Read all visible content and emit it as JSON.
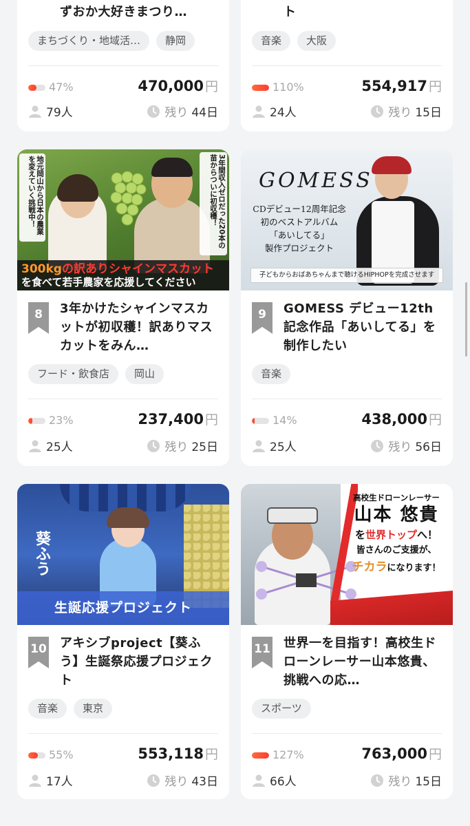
{
  "cards": [
    {
      "rank": "",
      "title": "ずおか大好きまつり…",
      "tags": [
        "まちづくり・地域活…",
        "静岡"
      ],
      "percent": "47%",
      "progress": 0.47,
      "amount": "470,000",
      "unit": "円",
      "supporters": "79人",
      "remaining_label": "残り",
      "remaining_days": "44日"
    },
    {
      "rank": "",
      "title": "ト",
      "tags": [
        "音楽",
        "大阪"
      ],
      "percent": "110%",
      "progress": 1.0,
      "amount": "554,917",
      "unit": "円",
      "supporters": "24人",
      "remaining_label": "残り",
      "remaining_days": "15日"
    },
    {
      "rank": "8",
      "title": "3年かけたシャインマスカットが初収穫！訳ありマスカットをみん…",
      "tags": [
        "フード・飲食店",
        "岡山"
      ],
      "percent": "23%",
      "progress": 0.23,
      "amount": "237,400",
      "unit": "円",
      "supporters": "25人",
      "remaining_label": "残り",
      "remaining_days": "25日",
      "image": {
        "left_caption": "地元岡山から日本の農業を変えていく挑戦中！",
        "right_caption": "3年間収入ゼロだった20本の苗からついに初収穫！",
        "banner_highlight": "300kg",
        "banner_red": "の訳ありシャインマスカット",
        "banner_line2": "を食べて若手農家を応援してください"
      }
    },
    {
      "rank": "9",
      "title": "GOMESS デビュー12th記念作品「あいしてる」を制作したい",
      "tags": [
        "音楽"
      ],
      "percent": "14%",
      "progress": 0.14,
      "amount": "438,000",
      "unit": "円",
      "supporters": "25人",
      "remaining_label": "残り",
      "remaining_days": "56日",
      "image": {
        "logo": "GOMESS",
        "line1": "CDデビュー12周年記念",
        "line2": "初のベストアルバム",
        "line3": "「あいしてる」",
        "line4": "製作プロジェクト",
        "bottom": "子どもからおばあちゃんまで聴けるHIPHOPを完成させます"
      }
    },
    {
      "rank": "10",
      "title": "アキシブproject【葵ふう】生誕祭応援プロジェクト",
      "tags": [
        "音楽",
        "東京"
      ],
      "percent": "55%",
      "progress": 0.55,
      "amount": "553,118",
      "unit": "円",
      "supporters": "17人",
      "remaining_label": "残り",
      "remaining_days": "43日",
      "image": {
        "name": "葵ふう",
        "banner": "生誕応援プロジェクト"
      }
    },
    {
      "rank": "11",
      "title": "世界一を目指す！高校生ドローンレーサー山本悠貴、挑戦への応…",
      "tags": [
        "スポーツ"
      ],
      "percent": "127%",
      "progress": 1.0,
      "amount": "763,000",
      "unit": "円",
      "supporters": "66人",
      "remaining_label": "残り",
      "remaining_days": "15日",
      "image": {
        "line1": "高校生ドローンレーサー",
        "name": "山本 悠貴",
        "line2a": "を",
        "line2b": "世界トップ",
        "line2c": "へ！",
        "line3": "皆さんのご支援が、",
        "line4a": "チカラ",
        "line4b": "になります！"
      }
    }
  ],
  "colors": {
    "background": "#f3f4f6",
    "card": "#ffffff",
    "rank_badge": "#999999",
    "progress_fill": "#ff5a33",
    "tag_bg": "#eeeff1"
  },
  "icons": {
    "supporters": "person-icon",
    "remaining": "clock-icon"
  }
}
